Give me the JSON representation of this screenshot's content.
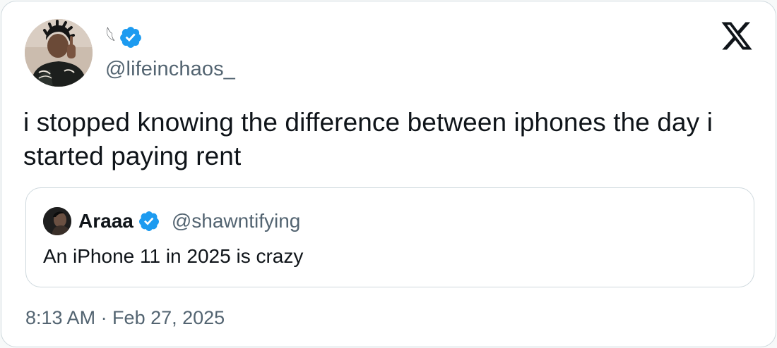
{
  "tweet": {
    "author": {
      "display_name": "𓆩",
      "handle": "@lifeinchaos_",
      "verified": true,
      "avatar_icon": "profile-photo"
    },
    "text": "i stopped knowing the difference between iphones the day i started paying rent",
    "timestamp": "8:13 AM · Feb 27, 2025",
    "brand_icon": "x-logo-icon",
    "quoted": {
      "display_name": "Araaa",
      "handle": "@shawntifying",
      "verified": true,
      "text": "An iPhone 11 in 2025 is crazy",
      "avatar_icon": "profile-photo"
    }
  },
  "colors": {
    "text_primary": "#0f1419",
    "text_secondary": "#536471",
    "verified_blue": "#1d9bf0",
    "border": "#cfd9de",
    "background": "#ffffff"
  }
}
